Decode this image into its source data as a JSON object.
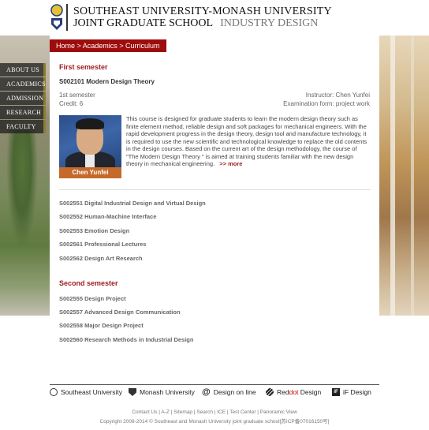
{
  "header": {
    "title_line1": "SOUTHEAST UNIVERSITY-MONASH UNIVERSITY",
    "title_line2": "JOINT GRADUATE SCHOOL",
    "title_line2_sub": "INDUSTRY DESIGN",
    "logo_icon": "shield-logo-icon"
  },
  "nav": {
    "items": [
      {
        "label": "ABOUT US"
      },
      {
        "label": "ACADEMICS"
      },
      {
        "label": "ADMISSION"
      },
      {
        "label": "RESEARCH"
      },
      {
        "label": "FACULTY"
      }
    ]
  },
  "breadcrumb": {
    "text": "Home > Academics > Curriculum"
  },
  "first_semester": {
    "title": "First semester",
    "featured": {
      "code_name": "S002101 Modern Design Theory",
      "semester": "1st semester",
      "instructor": "Instructor: Chen Yunfei",
      "credit": "Credit: 6",
      "exam": "Examination form: project work",
      "photo_caption": "Chen Yunfei",
      "description": "This course is designed for graduate students to learn the modern design theory such as finite element method, reliable design and soft packages for mechanical engineers. With the rapid development progress in the design theory, design tool and manufacture technology, it is required to use the new scientific and technological knowledge to replace the old contents in the design courses. Based on the current art of the design methodology, the course of \"The Modern Design Theory \" is aimed at training students familiar with the new design theory in mechanical engineering.",
      "more_label": ">> more"
    },
    "courses": [
      "S002551 Digital Industrial Design and Virtual Design",
      "S002552 Human-Machine Interface",
      "S002553 Emotion Design",
      "S002561 Professional Lectures",
      "S002562 Design Art Research"
    ]
  },
  "second_semester": {
    "title": "Second semester",
    "courses": [
      "S002555 Design Project",
      "S002557 Advanced Design Communication",
      "S002558 Major Design Project",
      "S002560 Research Methods in Industrial Design"
    ]
  },
  "partners": {
    "southeast": "Southeast University",
    "monash": "Monash University",
    "design_online": "Design on line",
    "reddot_red": "Red",
    "reddot_dot": "dot",
    "reddot_design": " Design",
    "if_design": "iF Design"
  },
  "footer": {
    "links": "Contact Us | A-Z | Sitemap | Search | ICE | Test Center | Panoramic View",
    "copyright": "Copyright 2008-2014 © Southeast and Monash University joint graduate school[苏ICP备07016150号]"
  },
  "colors": {
    "accent_red": "#9e0c0c",
    "nav_bg": "#232323"
  }
}
